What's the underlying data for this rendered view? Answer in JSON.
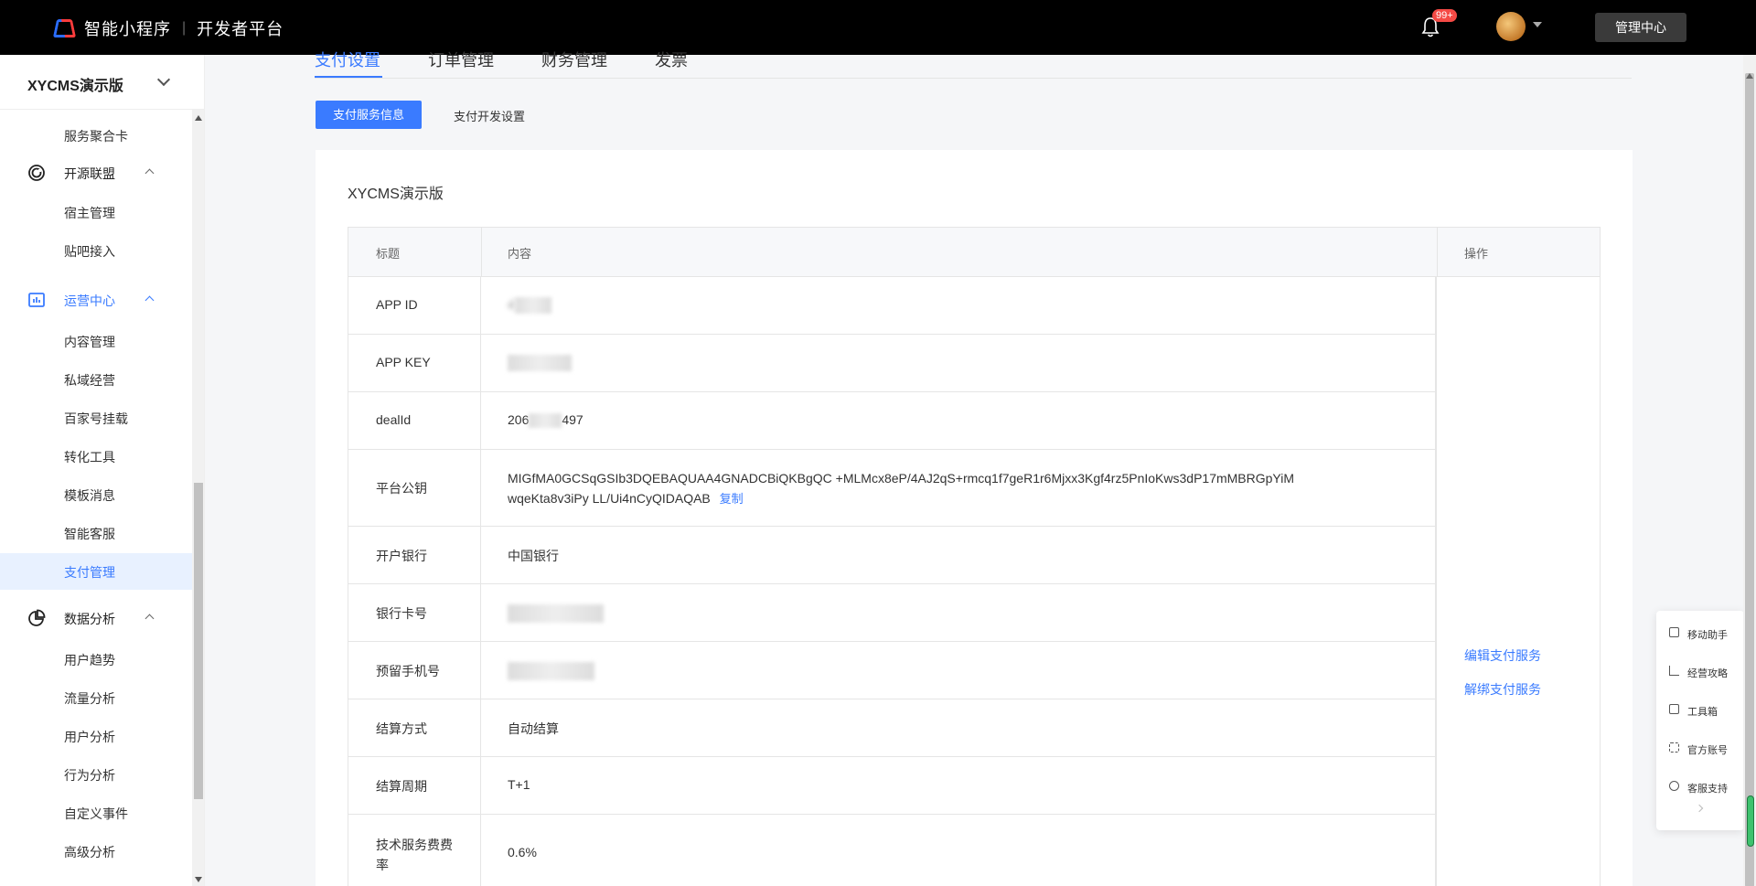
{
  "topbar": {
    "brand": "智能小程序",
    "separator": "|",
    "subtitle": "开发者平台",
    "notification_badge": "99+",
    "admin_button": "管理中心"
  },
  "sidebar": {
    "app_name": "XYCMS演示版",
    "items": [
      {
        "type": "item",
        "label": "服务聚合卡"
      },
      {
        "type": "group",
        "label": "开源联盟",
        "icon": "opensource-icon"
      },
      {
        "type": "item",
        "label": "宿主管理"
      },
      {
        "type": "item",
        "label": "贴吧接入"
      },
      {
        "type": "group",
        "label": "运营中心",
        "icon": "operations-chart-icon"
      },
      {
        "type": "item",
        "label": "内容管理"
      },
      {
        "type": "item",
        "label": "私域经营"
      },
      {
        "type": "item",
        "label": "百家号挂载"
      },
      {
        "type": "item",
        "label": "转化工具"
      },
      {
        "type": "item",
        "label": "模板消息"
      },
      {
        "type": "item",
        "label": "智能客服"
      },
      {
        "type": "item",
        "label": "支付管理",
        "active": true
      },
      {
        "type": "group",
        "label": "数据分析",
        "icon": "pie-chart-icon"
      },
      {
        "type": "item",
        "label": "用户趋势"
      },
      {
        "type": "item",
        "label": "流量分析"
      },
      {
        "type": "item",
        "label": "用户分析"
      },
      {
        "type": "item",
        "label": "行为分析"
      },
      {
        "type": "item",
        "label": "自定义事件"
      },
      {
        "type": "item",
        "label": "高级分析"
      }
    ]
  },
  "main": {
    "tabs": [
      {
        "label": "支付设置",
        "active": true
      },
      {
        "label": "订单管理"
      },
      {
        "label": "财务管理"
      },
      {
        "label": "发票"
      }
    ],
    "subtabs": {
      "primary": "支付服务信息",
      "secondary": "支付开发设置"
    },
    "card_title": "XYCMS演示版",
    "table": {
      "headers": {
        "title": "标题",
        "content": "内容",
        "action": "操作"
      },
      "rows": [
        {
          "title": "APP ID",
          "value": "4",
          "blurred": true
        },
        {
          "title": "APP KEY",
          "value": "",
          "blurred": true
        },
        {
          "title": "dealId",
          "value_prefix": "206",
          "value_suffix": "497"
        },
        {
          "title": "平台公钥",
          "line1": "MIGfMA0GCSqGSIb3DQEBAQUAA4GNADCBiQKBgQC +MLMcx8eP/4AJ2qS+rmcq1f7geR1r6Mjxx3Kgf4rz5PnIoKws3dP17mMBRGpYiM",
          "line2": "wqeKta8v3iPy LL/Ui4nCyQIDAQAB",
          "copy": "复制"
        },
        {
          "title": "开户银行",
          "value": "中国银行"
        },
        {
          "title": "银行卡号",
          "value": "",
          "blurred": true
        },
        {
          "title": "预留手机号",
          "value": "",
          "blurred": true
        },
        {
          "title": "结算方式",
          "value": "自动结算"
        },
        {
          "title": "结算周期",
          "value": "T+1"
        },
        {
          "title": "技术服务费费率",
          "value": "0.6%"
        }
      ],
      "actions": [
        "编辑支付服务",
        "解绑支付服务"
      ]
    }
  },
  "helper": {
    "items": [
      {
        "label": "移动助手",
        "icon": "mobile-icon"
      },
      {
        "label": "经营攻略",
        "icon": "strategy-icon"
      },
      {
        "label": "工具箱",
        "icon": "toolbox-icon"
      },
      {
        "label": "官方账号",
        "icon": "official-account-icon"
      },
      {
        "label": "客服支持",
        "icon": "headset-icon"
      }
    ]
  },
  "colors": {
    "accent": "#3a7bff",
    "topbar": "#000000",
    "badge": "#f54a45"
  }
}
